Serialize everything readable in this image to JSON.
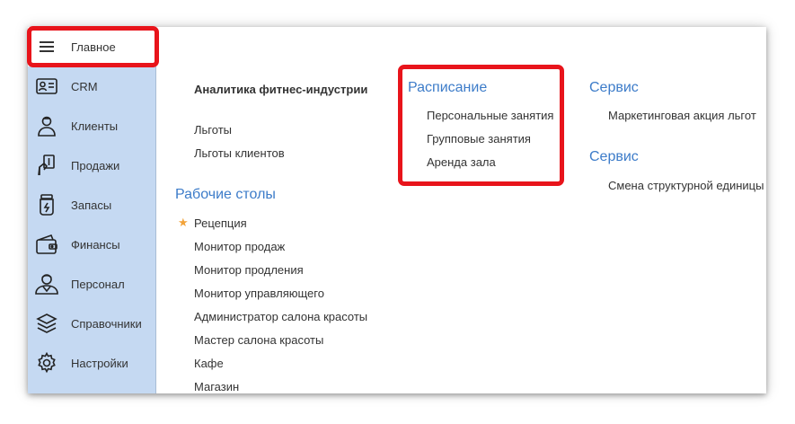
{
  "sidebar": {
    "items": [
      {
        "label": "Главное",
        "icon": "menu-icon"
      },
      {
        "label": "CRM",
        "icon": "id-card-icon"
      },
      {
        "label": "Клиенты",
        "icon": "client-person-icon"
      },
      {
        "label": "Продажи",
        "icon": "hand-money-icon"
      },
      {
        "label": "Запасы",
        "icon": "jar-icon"
      },
      {
        "label": "Финансы",
        "icon": "wallet-icon"
      },
      {
        "label": "Персонал",
        "icon": "staff-person-icon"
      },
      {
        "label": "Справочники",
        "icon": "layers-icon"
      },
      {
        "label": "Настройки",
        "icon": "gear-icon"
      }
    ]
  },
  "column1": {
    "analytics_title": "Аналитика фитнес-индустрии",
    "links": [
      "Льготы",
      "Льготы клиентов"
    ],
    "desktops_heading": "Рабочие столы",
    "desktops": [
      "Рецепция",
      "Монитор продаж",
      "Монитор продления",
      "Монитор управляющего",
      "Администратор салона красоты",
      "Мастер салона красоты",
      "Кафе",
      "Магазин"
    ]
  },
  "column2": {
    "heading": "Расписание",
    "items": [
      "Персональные занятия",
      "Групповые занятия",
      "Аренда зала"
    ]
  },
  "column3": {
    "service1_heading": "Сервис",
    "service1_items": [
      "Маркетинговая акция льгот"
    ],
    "service2_heading": "Сервис",
    "service2_items": [
      "Смена структурной единицы"
    ]
  },
  "colors": {
    "sidebar_bg": "#c5d9f2",
    "heading_blue": "#3d7cc9",
    "highlight_red": "#e8141b",
    "favorite_star": "#f2a33a"
  }
}
